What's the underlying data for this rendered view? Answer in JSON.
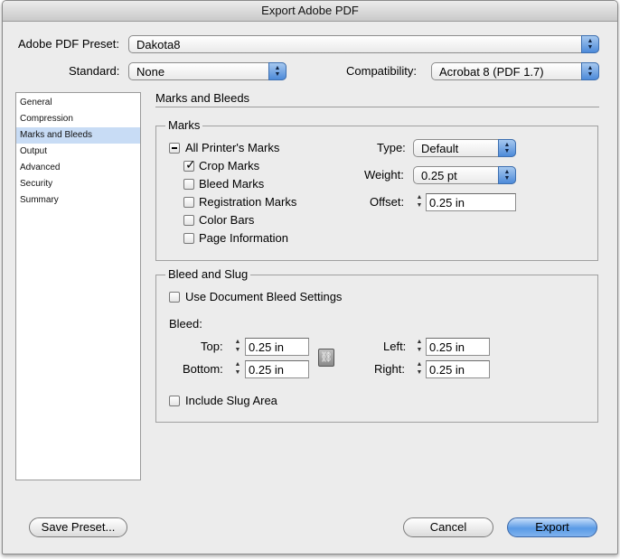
{
  "window": {
    "title": "Export Adobe PDF"
  },
  "preset": {
    "label": "Adobe PDF Preset:",
    "value": "Dakota8"
  },
  "standard": {
    "label": "Standard:",
    "value": "None"
  },
  "compatibility": {
    "label": "Compatibility:",
    "value": "Acrobat 8 (PDF 1.7)"
  },
  "sidebar": {
    "items": [
      {
        "label": "General"
      },
      {
        "label": "Compression"
      },
      {
        "label": "Marks and Bleeds"
      },
      {
        "label": "Output"
      },
      {
        "label": "Advanced"
      },
      {
        "label": "Security"
      },
      {
        "label": "Summary"
      }
    ],
    "selected": "Marks and Bleeds"
  },
  "section_title": "Marks and Bleeds",
  "marks": {
    "group_label": "Marks",
    "all_printers_marks": {
      "label": "All Printer's Marks",
      "state": "mixed"
    },
    "crop_marks": {
      "label": "Crop Marks",
      "checked": true
    },
    "bleed_marks": {
      "label": "Bleed Marks",
      "checked": false
    },
    "registration_marks": {
      "label": "Registration Marks",
      "checked": false
    },
    "color_bars": {
      "label": "Color Bars",
      "checked": false
    },
    "page_information": {
      "label": "Page Information",
      "checked": false
    },
    "type": {
      "label": "Type:",
      "value": "Default"
    },
    "weight": {
      "label": "Weight:",
      "value": "0.25 pt"
    },
    "offset": {
      "label": "Offset:",
      "value": "0.25 in"
    }
  },
  "bleed_slug": {
    "group_label": "Bleed and Slug",
    "use_document_bleed": {
      "label": "Use Document Bleed Settings",
      "checked": false
    },
    "bleed_label": "Bleed:",
    "top": {
      "label": "Top:",
      "value": "0.25 in"
    },
    "bottom": {
      "label": "Bottom:",
      "value": "0.25 in"
    },
    "left": {
      "label": "Left:",
      "value": "0.25 in"
    },
    "right": {
      "label": "Right:",
      "value": "0.25 in"
    },
    "include_slug": {
      "label": "Include Slug Area",
      "checked": false
    }
  },
  "buttons": {
    "save_preset": "Save Preset...",
    "cancel": "Cancel",
    "export": "Export"
  },
  "colors": {
    "accent": "#5a9be6",
    "selection": "#c8dcf5"
  },
  "icons": {
    "popup_arrows": "▲▼",
    "check": "✓",
    "link": "chain-link-icon"
  }
}
